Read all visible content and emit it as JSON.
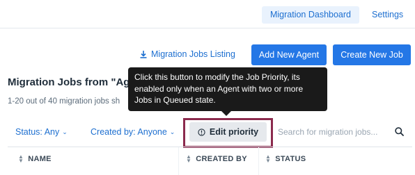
{
  "nav": {
    "tabs": [
      {
        "label": "Migration Dashboard",
        "active": true
      },
      {
        "label": "Settings",
        "active": false
      }
    ]
  },
  "actions": {
    "listing_link": "Migration Jobs Listing",
    "add_agent": "Add New Agent",
    "create_job": "Create New Job"
  },
  "page": {
    "title": "Migration Jobs from \"Ag",
    "count": "1-20 out of 40 migration jobs sh"
  },
  "filters": {
    "status": "Status: Any",
    "created_by": "Created by: Anyone"
  },
  "toolbar": {
    "edit_priority": "Edit priority"
  },
  "search": {
    "placeholder": "Search for migration jobs..."
  },
  "tooltip": {
    "text": "Click this button to modify the Job Priority, its enabled only when an Agent with two or more Jobs in Queued state."
  },
  "table": {
    "columns": [
      "NAME",
      "CREATED BY",
      "STATUS"
    ]
  },
  "colors": {
    "accent": "#2477e6",
    "link": "#1d6fd0",
    "highlight_border": "#8b2a4d",
    "tooltip_bg": "#1a1a1a"
  },
  "icons": [
    "download-icon",
    "chevron-down-icon",
    "info-circle-icon",
    "search-icon",
    "sort-icon"
  ]
}
